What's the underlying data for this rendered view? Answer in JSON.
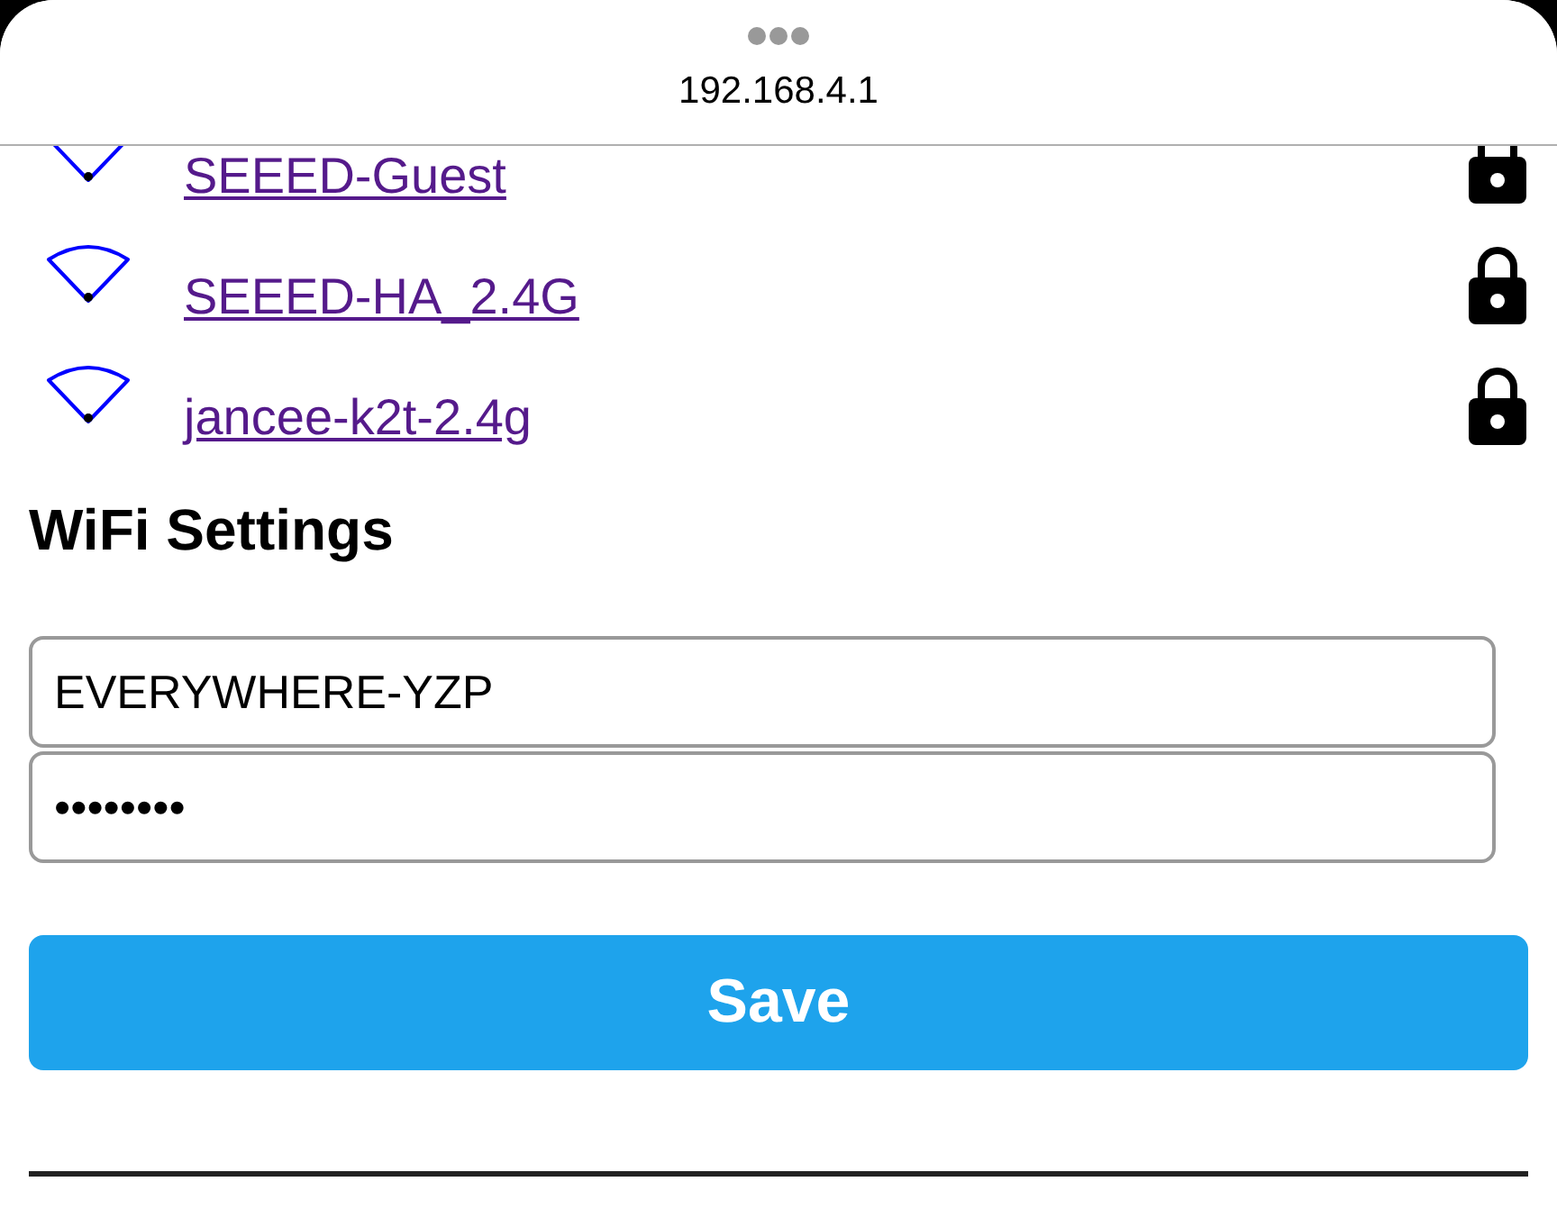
{
  "browser": {
    "url": "192.168.4.1"
  },
  "networks": [
    {
      "name": "SEEED-Guest",
      "locked": true
    },
    {
      "name": "SEEED-HA_2.4G",
      "locked": true
    },
    {
      "name": "jancee-k2t-2.4g",
      "locked": true
    }
  ],
  "settings": {
    "title": "WiFi Settings",
    "ssid": "EVERYWHERE-YZP",
    "password": "••••••••",
    "button": "Save"
  }
}
